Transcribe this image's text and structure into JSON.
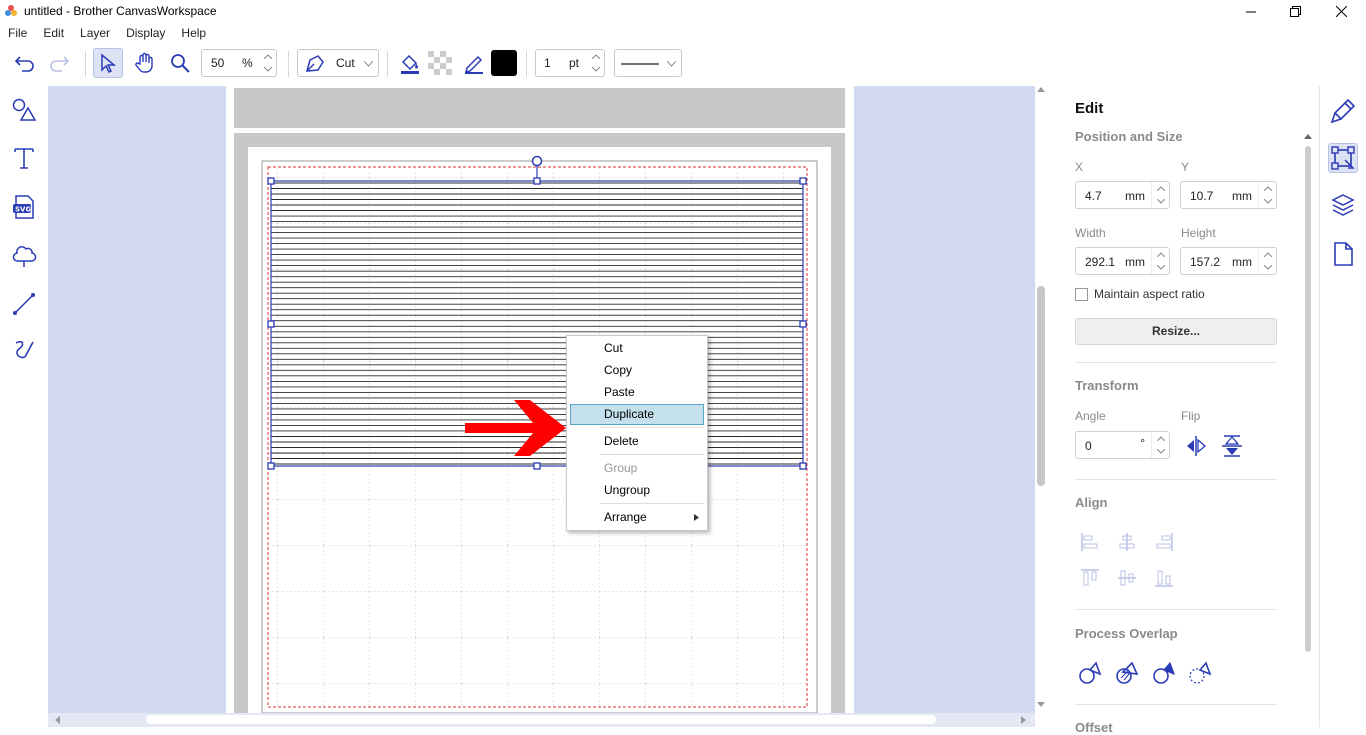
{
  "window": {
    "title": "untitled - Brother CanvasWorkspace"
  },
  "menu": [
    "File",
    "Edit",
    "Layer",
    "Display",
    "Help"
  ],
  "toolbar": {
    "zoom_value": "50",
    "zoom_unit": "%",
    "line_mode": "Cut",
    "stroke_width": "1",
    "stroke_unit": "pt",
    "fill_color": "#000000"
  },
  "left_tools": [
    "shapes-icon",
    "text-icon",
    "svg-import-icon",
    "cloud-shape-icon",
    "line-tool-icon",
    "freehand-tool-icon"
  ],
  "context_menu": {
    "items": [
      {
        "label": "Cut",
        "state": "normal"
      },
      {
        "label": "Copy",
        "state": "normal"
      },
      {
        "label": "Paste",
        "state": "normal"
      },
      {
        "label": "Duplicate",
        "state": "highlighted"
      },
      {
        "label": "Delete",
        "state": "normal"
      },
      {
        "label": "Group",
        "state": "disabled"
      },
      {
        "label": "Ungroup",
        "state": "normal"
      },
      {
        "label": "Arrange",
        "state": "submenu"
      }
    ]
  },
  "panel": {
    "title": "Edit",
    "position_size": {
      "heading": "Position and Size",
      "x_label": "X",
      "x_value": "4.7",
      "x_unit": "mm",
      "y_label": "Y",
      "y_value": "10.7",
      "y_unit": "mm",
      "width_label": "Width",
      "width_value": "292.1",
      "width_unit": "mm",
      "height_label": "Height",
      "height_value": "157.2",
      "height_unit": "mm",
      "aspect_label": "Maintain aspect ratio",
      "resize_label": "Resize..."
    },
    "transform": {
      "heading": "Transform",
      "angle_label": "Angle",
      "angle_value": "0",
      "angle_unit": "°",
      "flip_label": "Flip"
    },
    "align": {
      "heading": "Align"
    },
    "process_overlap": {
      "heading": "Process Overlap"
    },
    "offset": {
      "heading": "Offset"
    }
  },
  "right_tabs": [
    "paint-brush-icon",
    "edit-transform-icon",
    "layers-icon",
    "page-icon"
  ],
  "colors": {
    "accent": "#2a3bb5",
    "canvas_bg": "#d0d9f0",
    "highlight": "#c4e0ec",
    "arrow": "#ff0000"
  }
}
